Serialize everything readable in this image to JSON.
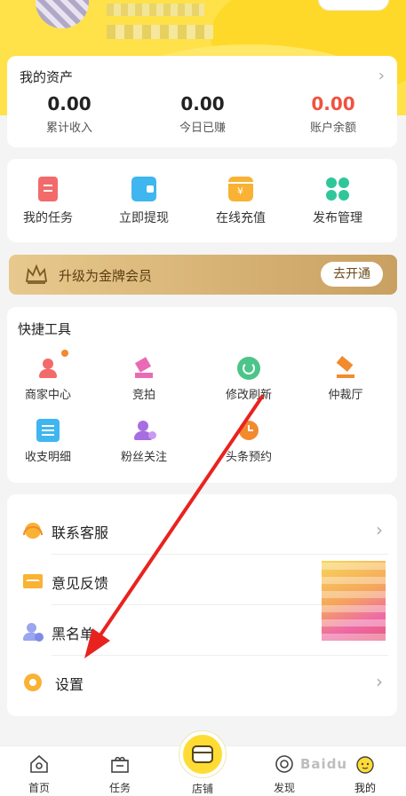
{
  "assets": {
    "title": "我的资产",
    "stats": [
      {
        "value": "0.00",
        "label": "累计收入"
      },
      {
        "value": "0.00",
        "label": "今日已赚"
      },
      {
        "value": "0.00",
        "label": "账户余额"
      }
    ]
  },
  "actions": [
    "我的任务",
    "立即提现",
    "在线充值",
    "发布管理"
  ],
  "vip": {
    "text": "升级为金牌会员",
    "button": "去开通"
  },
  "tools": {
    "title": "快捷工具",
    "items": [
      "商家中心",
      "竞拍",
      "修改刷新",
      "仲裁厅",
      "收支明细",
      "粉丝关注",
      "头条预约"
    ]
  },
  "menu": [
    "联系客服",
    "意见反馈",
    "黑名单",
    "设置"
  ],
  "tabbar": {
    "items": [
      "首页",
      "任务",
      "店铺",
      "发现",
      "我的"
    ]
  },
  "watermark": "Baidu",
  "colors": {
    "accent": "#ffdc33",
    "red": "#f0523f",
    "vip_gold": "#c9a062"
  }
}
